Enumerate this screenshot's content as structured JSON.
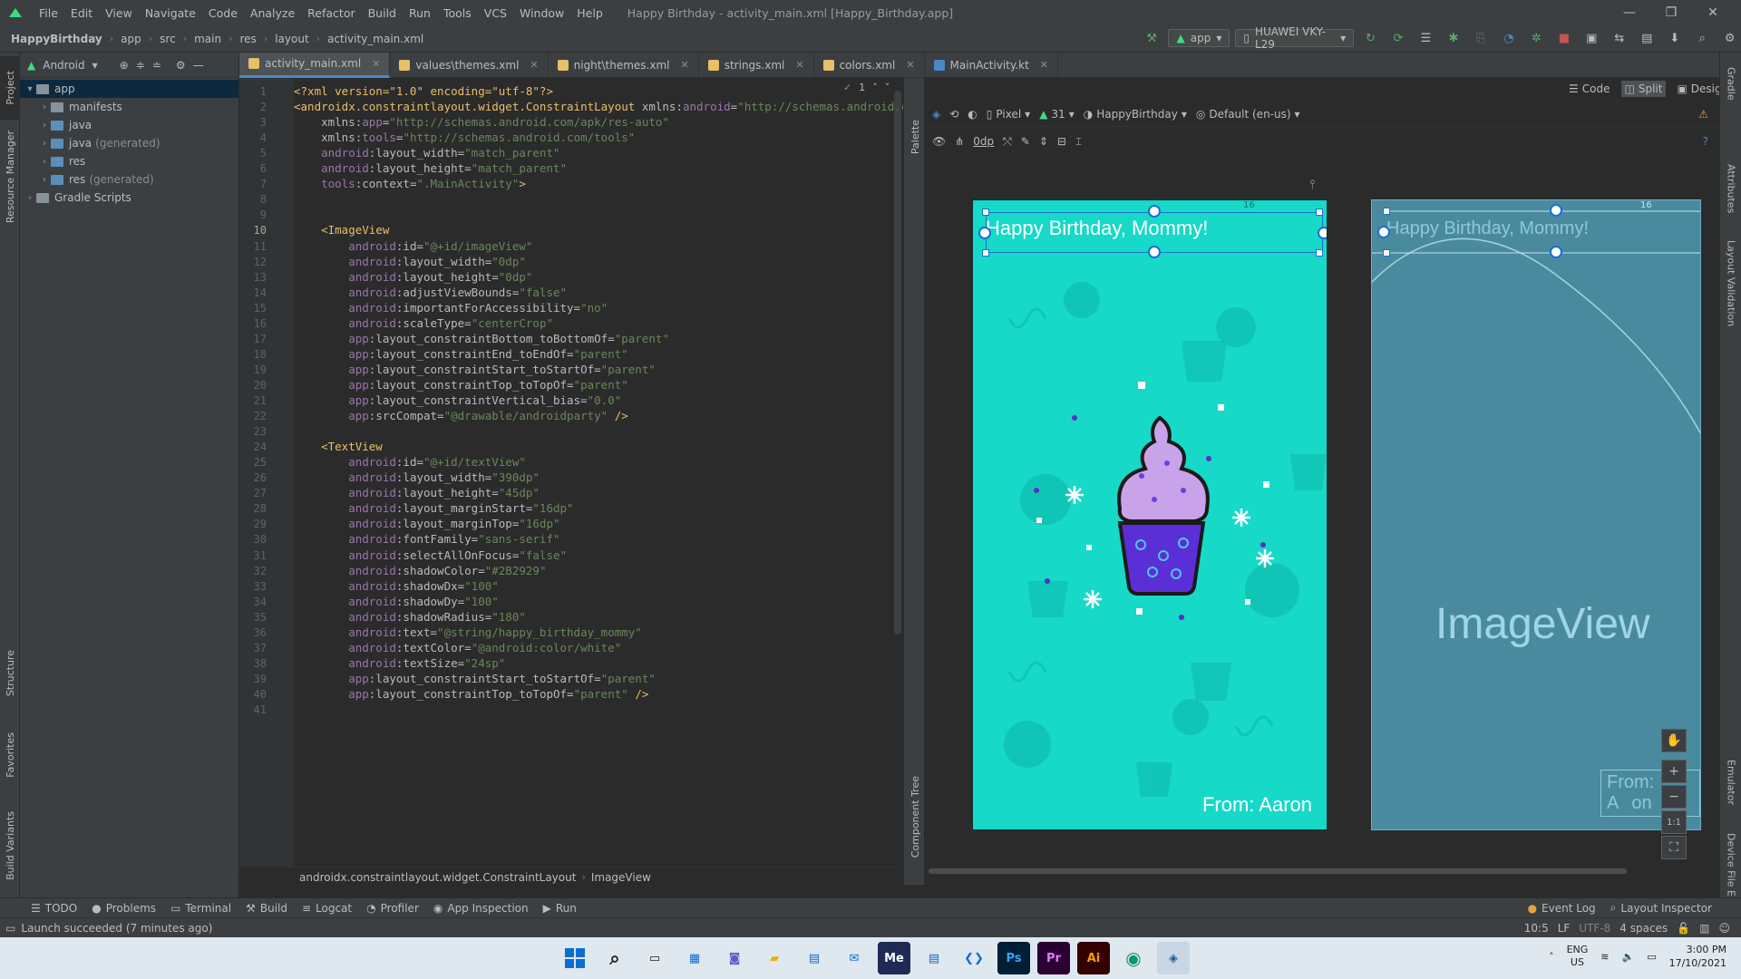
{
  "window": {
    "title": "Happy Birthday - activity_main.xml [Happy_Birthday.app]",
    "controls": [
      "—",
      "❐",
      "✕"
    ]
  },
  "menu": [
    "File",
    "Edit",
    "View",
    "Navigate",
    "Code",
    "Analyze",
    "Refactor",
    "Build",
    "Run",
    "Tools",
    "VCS",
    "Window",
    "Help"
  ],
  "breadcrumb": [
    "HappyBirthday",
    "app",
    "src",
    "main",
    "res",
    "layout",
    "activity_main.xml"
  ],
  "toolbar": {
    "run_config": "app",
    "device": "HUAWEI VKY-L29"
  },
  "project": {
    "view_mode": "Android",
    "tree": [
      {
        "label": "app",
        "muted": "",
        "level": 0,
        "expanded": true,
        "selected": true
      },
      {
        "label": "manifests",
        "muted": "",
        "level": 1,
        "expanded": false
      },
      {
        "label": "java",
        "muted": "",
        "level": 1,
        "expanded": false
      },
      {
        "label": "java",
        "muted": "(generated)",
        "level": 1,
        "expanded": false
      },
      {
        "label": "res",
        "muted": "",
        "level": 1,
        "expanded": false
      },
      {
        "label": "res",
        "muted": "(generated)",
        "level": 1,
        "expanded": false
      },
      {
        "label": "Gradle Scripts",
        "muted": "",
        "level": 0,
        "expanded": false
      }
    ]
  },
  "left_tabs": [
    "Project",
    "Resource Manager",
    "Structure",
    "Favorites",
    "Build Variants"
  ],
  "right_tabs": [
    "Gradle",
    "Layout Validation",
    "Emulator",
    "Device File Explorer"
  ],
  "tabs": [
    {
      "label": "activity_main.xml",
      "active": true
    },
    {
      "label": "values\\themes.xml",
      "active": false
    },
    {
      "label": "night\\themes.xml",
      "active": false
    },
    {
      "label": "strings.xml",
      "active": false
    },
    {
      "label": "colors.xml",
      "active": false
    },
    {
      "label": "MainActivity.kt",
      "active": false
    }
  ],
  "editor": {
    "current_line": 10,
    "warning_count": "1",
    "lines": [
      [
        [
          "pi",
          "<?xml version=\"1.0\" encoding=\"utf-8\"?>"
        ]
      ],
      [
        [
          "tag",
          "<androidx.constraintlayout.widget.ConstraintLayout "
        ],
        [
          "attr",
          "xmlns:"
        ],
        [
          "ns",
          "android"
        ],
        [
          "attr",
          "="
        ],
        [
          "val",
          "\"http://schemas.android.com/apk/res/android\""
        ]
      ],
      [
        [
          "attr",
          "    xmlns:"
        ],
        [
          "ns",
          "app"
        ],
        [
          "attr",
          "="
        ],
        [
          "val",
          "\"http://schemas.android.com/apk/res-auto\""
        ]
      ],
      [
        [
          "attr",
          "    xmlns:"
        ],
        [
          "ns",
          "tools"
        ],
        [
          "attr",
          "="
        ],
        [
          "val",
          "\"http://schemas.android.com/tools\""
        ]
      ],
      [
        [
          "ns",
          "    android"
        ],
        [
          "attr",
          ":layout_width="
        ],
        [
          "val",
          "\"match_parent\""
        ]
      ],
      [
        [
          "ns",
          "    android"
        ],
        [
          "attr",
          ":layout_height="
        ],
        [
          "val",
          "\"match_parent\""
        ]
      ],
      [
        [
          "ns",
          "    tools"
        ],
        [
          "attr",
          ":context="
        ],
        [
          "val",
          "\".MainActivity\""
        ],
        [
          "tag",
          ">"
        ]
      ],
      [],
      [],
      [
        [
          "tag",
          "    <ImageView"
        ]
      ],
      [
        [
          "ns",
          "        android"
        ],
        [
          "attr",
          ":id="
        ],
        [
          "val",
          "\"@+id/imageView\""
        ]
      ],
      [
        [
          "ns",
          "        android"
        ],
        [
          "attr",
          ":layout_width="
        ],
        [
          "val",
          "\"0dp\""
        ]
      ],
      [
        [
          "ns",
          "        android"
        ],
        [
          "attr",
          ":layout_height="
        ],
        [
          "val",
          "\"0dp\""
        ]
      ],
      [
        [
          "ns",
          "        android"
        ],
        [
          "attr",
          ":adjustViewBounds="
        ],
        [
          "val",
          "\"false\""
        ]
      ],
      [
        [
          "ns",
          "        android"
        ],
        [
          "attr",
          ":importantForAccessibility="
        ],
        [
          "val",
          "\"no\""
        ]
      ],
      [
        [
          "ns",
          "        android"
        ],
        [
          "attr",
          ":scaleType="
        ],
        [
          "val",
          "\"centerCrop\""
        ]
      ],
      [
        [
          "ns",
          "        app"
        ],
        [
          "attr",
          ":layout_constraintBottom_toBottomOf="
        ],
        [
          "val",
          "\"parent\""
        ]
      ],
      [
        [
          "ns",
          "        app"
        ],
        [
          "attr",
          ":layout_constraintEnd_toEndOf="
        ],
        [
          "val",
          "\"parent\""
        ]
      ],
      [
        [
          "ns",
          "        app"
        ],
        [
          "attr",
          ":layout_constraintStart_toStartOf="
        ],
        [
          "val",
          "\"parent\""
        ]
      ],
      [
        [
          "ns",
          "        app"
        ],
        [
          "attr",
          ":layout_constraintTop_toTopOf="
        ],
        [
          "val",
          "\"parent\""
        ]
      ],
      [
        [
          "ns",
          "        app"
        ],
        [
          "attr",
          ":layout_constraintVertical_bias="
        ],
        [
          "val",
          "\"0.0\""
        ]
      ],
      [
        [
          "ns",
          "        app"
        ],
        [
          "attr",
          ":srcCompat="
        ],
        [
          "val",
          "\"@drawable/androidparty\""
        ],
        [
          "tag",
          " />"
        ]
      ],
      [],
      [
        [
          "tag",
          "    <TextView"
        ]
      ],
      [
        [
          "ns",
          "        android"
        ],
        [
          "attr",
          ":id="
        ],
        [
          "val",
          "\"@+id/textView\""
        ]
      ],
      [
        [
          "ns",
          "        android"
        ],
        [
          "attr",
          ":layout_width="
        ],
        [
          "val",
          "\"390dp\""
        ]
      ],
      [
        [
          "ns",
          "        android"
        ],
        [
          "attr",
          ":layout_height="
        ],
        [
          "val",
          "\"45dp\""
        ]
      ],
      [
        [
          "ns",
          "        android"
        ],
        [
          "attr",
          ":layout_marginStart="
        ],
        [
          "val",
          "\"16dp\""
        ]
      ],
      [
        [
          "ns",
          "        android"
        ],
        [
          "attr",
          ":layout_marginTop="
        ],
        [
          "val",
          "\"16dp\""
        ]
      ],
      [
        [
          "ns",
          "        android"
        ],
        [
          "attr",
          ":fontFamily="
        ],
        [
          "val",
          "\"sans-serif\""
        ]
      ],
      [
        [
          "ns",
          "        android"
        ],
        [
          "attr",
          ":selectAllOnFocus="
        ],
        [
          "val",
          "\"false\""
        ]
      ],
      [
        [
          "ns",
          "        android"
        ],
        [
          "attr",
          ":shadowColor="
        ],
        [
          "val",
          "\"#2B2929\""
        ]
      ],
      [
        [
          "ns",
          "        android"
        ],
        [
          "attr",
          ":shadowDx="
        ],
        [
          "val",
          "\"100\""
        ]
      ],
      [
        [
          "ns",
          "        android"
        ],
        [
          "attr",
          ":shadowDy="
        ],
        [
          "val",
          "\"100\""
        ]
      ],
      [
        [
          "ns",
          "        android"
        ],
        [
          "attr",
          ":shadowRadius="
        ],
        [
          "val",
          "\"180\""
        ]
      ],
      [
        [
          "ns",
          "        android"
        ],
        [
          "attr",
          ":text="
        ],
        [
          "val",
          "\"@string/happy_birthday_mommy\""
        ]
      ],
      [
        [
          "ns",
          "        android"
        ],
        [
          "attr",
          ":textColor="
        ],
        [
          "val",
          "\"@android:color/white\""
        ]
      ],
      [
        [
          "ns",
          "        android"
        ],
        [
          "attr",
          ":textSize="
        ],
        [
          "val",
          "\"24sp\""
        ]
      ],
      [
        [
          "ns",
          "        app"
        ],
        [
          "attr",
          ":layout_constraintStart_toStartOf="
        ],
        [
          "val",
          "\"parent\""
        ]
      ],
      [
        [
          "ns",
          "        app"
        ],
        [
          "attr",
          ":layout_constraintTop_toTopOf="
        ],
        [
          "val",
          "\"parent\""
        ],
        [
          "tag",
          " />"
        ]
      ],
      []
    ],
    "code_breadcrumb": [
      "androidx.constraintlayout.widget.ConstraintLayout",
      "ImageView"
    ]
  },
  "design": {
    "view_modes": [
      "Code",
      "Split",
      "Design"
    ],
    "device": "Pixel",
    "api": "31",
    "theme": "HappyBirthday",
    "locale": "Default (en-us)",
    "margin": "0dp",
    "palette_label": "Palette",
    "component_tree_label": "Component Tree",
    "attributes_label": "Attributes",
    "preview_text_top": "Happy Birthday, Mommy!",
    "preview_text_bottom": "From: Aaron",
    "blueprint_imageview": "ImageView",
    "blueprint_from": "From: A",
    "blueprint_from_tail": "on",
    "margin_marker": "16",
    "zoom_reset": "1:1",
    "background_color": "#16d9c7"
  },
  "bottom_tools": [
    "TODO",
    "Problems",
    "Terminal",
    "Build",
    "Logcat",
    "Profiler",
    "App Inspection",
    "Run"
  ],
  "bottom_tools_right": [
    "Event Log",
    "Layout Inspector"
  ],
  "status": {
    "message": "Launch succeeded (7 minutes ago)",
    "position": "10:5",
    "line_sep": "LF",
    "encoding": "UTF-8",
    "indent": "4 spaces"
  },
  "taskbar": {
    "apps": [
      "Me",
      "Ps",
      "Pr",
      "Ai"
    ],
    "lang": "ENG",
    "region": "US",
    "time": "3:00 PM",
    "date": "17/10/2021"
  }
}
